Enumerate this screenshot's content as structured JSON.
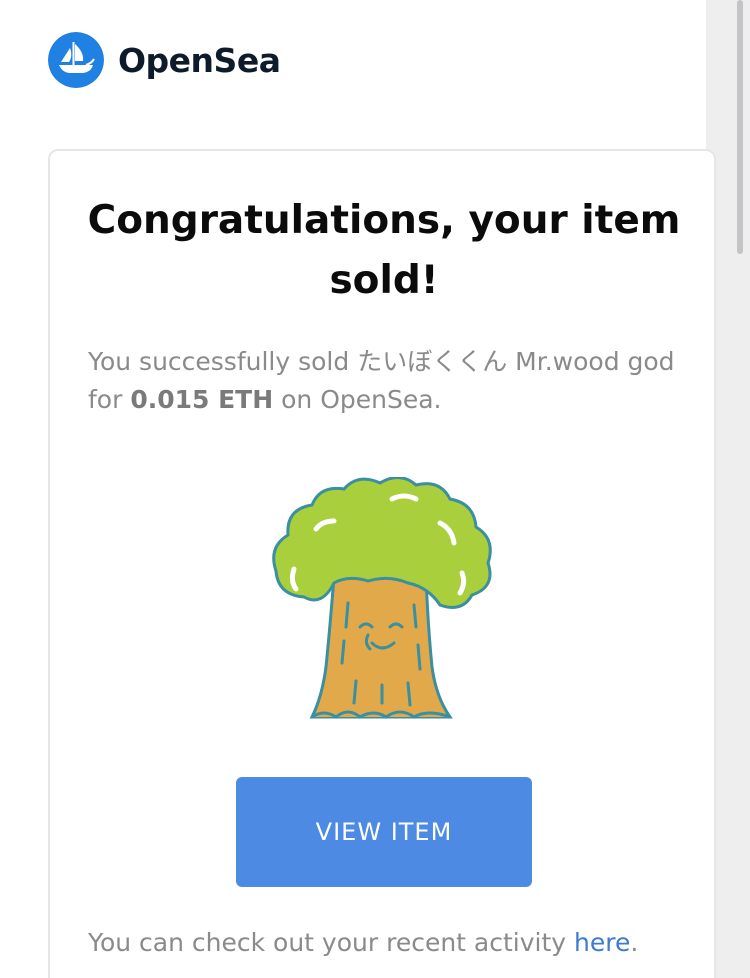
{
  "brand": {
    "name": "OpenSea",
    "logo_icon": "opensea-ship-logo-icon",
    "logo_color": "#2081E2"
  },
  "email": {
    "title": "Congratulations, your item sold!",
    "message": {
      "prefix": "You successfully sold ",
      "item_name": "たいぼくくん Mr.wood god",
      "middle": " for ",
      "price": "0.015 ETH",
      "suffix": " on OpenSea."
    },
    "item_image_icon": "tree-character-icon",
    "view_button_label": "VIEW ITEM",
    "view_button_color": "#4C8AE4",
    "footer": {
      "prefix": "You can check out your recent activity ",
      "link_label": "here",
      "suffix": "."
    }
  }
}
